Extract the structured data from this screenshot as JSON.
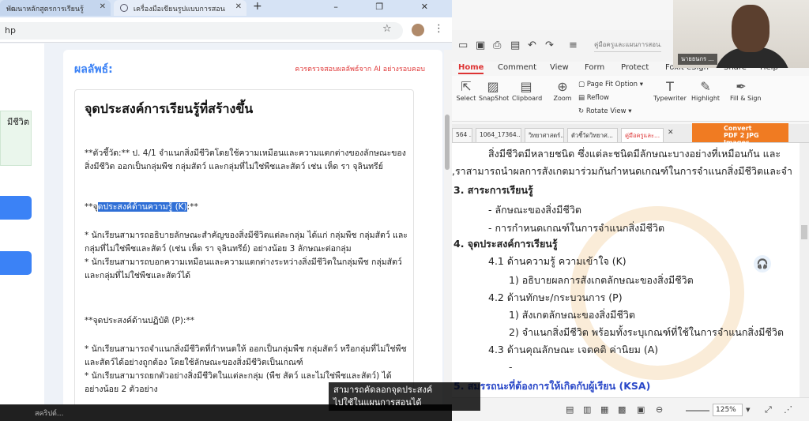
{
  "chrome": {
    "tabs": [
      {
        "label": "พัฒนาหลักสูตรการเรียนรู้"
      },
      {
        "label": "เครื่องมือเขียนรูปแบบการสอน"
      }
    ],
    "newtab": "+",
    "url": "hp",
    "window_controls": "–  ❐  ✕"
  },
  "webpage": {
    "left_text": "มีชีวิต",
    "result_title": "ผลลัพธ์:",
    "result_warning": "ควรตรวจสอบผลลัพธ์จาก AI อย่างรอบคอบ",
    "content": {
      "heading": "จุดประสงค์การเรียนรู้ที่สร้างขึ้น",
      "indicator": "**ตัวชี้วัด:** ป. 4/1 จำแนกสิ่งมีชีวิตโดยใช้ความเหมือนและความแตกต่างของลักษณะของสิ่งมีชีวิต ออกเป็นกลุ่มพืช กลุ่มสัตว์ และกลุ่มที่ไม่ใช่พืชและสัตว์ เช่น เห็ด รา จุลินทรีย์",
      "k_prefix": "**จ",
      "k_highlight": "ุดประสงค์ด้านความรู้ (K)",
      "k_suffix": ":**",
      "k_items": "* นักเรียนสามารถอธิบายลักษณะสำคัญของสิ่งมีชีวิตแต่ละกลุ่ม ได้แก่ กลุ่มพืช กลุ่มสัตว์ และกลุ่มที่ไม่ใช่พืชและสัตว์ (เช่น เห็ด รา จุลินทรีย์) อย่างน้อย 3 ลักษณะต่อกลุ่ม\n* นักเรียนสามารถบอกความเหมือนและความแตกต่างระหว่างสิ่งมีชีวิตในกลุ่มพืช กลุ่มสัตว์ และกลุ่มที่ไม่ใช่พืชและสัตว์ได้",
      "p_heading": "**จุดประสงค์ด้านปฏิบัติ (P):**",
      "p_items": "* นักเรียนสามารถจำแนกสิ่งมีชีวิตที่กำหนดให้ ออกเป็นกลุ่มพืช กลุ่มสัตว์ หรือกลุ่มที่ไม่ใช่พืชและสัตว์ได้อย่างถูกต้อง โดยใช้ลักษณะของสิ่งมีชีวิตเป็นเกณฑ์\n* นักเรียนสามารถยกตัวอย่างสิ่งมีชีวิตในแต่ละกลุ่ม (พืช สัตว์ และไม่ใช่พืชและสัตว์) ได้อย่างน้อย 2 ตัวอย่าง"
    }
  },
  "pdf": {
    "title_field": "คู่มือครูและแผนการสอน...",
    "ribbon_tabs": [
      "Home",
      "Comment",
      "View",
      "Form",
      "Protect",
      "Foxit eSign",
      "Share",
      "Help"
    ],
    "ribbon_buttons": {
      "select": "Select",
      "snapshot": "SnapShot",
      "clipboard": "Clipboard",
      "zoom": "Zoom",
      "page_fit": "Page Fit Option",
      "reflow": "Reflow",
      "rotate": "Rotate View",
      "typewriter": "Typewriter",
      "highlight": "Highlight",
      "fill_sign": "Fill & Sign"
    },
    "doc_tabs": [
      "564 ...",
      "1064_17364...",
      "วิทยาศาสตร์...",
      "ตัวชี้วัดวิทยาศ...",
      "คู่มือครูและ..."
    ],
    "convert": {
      "line1": "Convert",
      "line2": "PDF 2 JPG Images"
    },
    "page_lines": {
      "l1": "สิ่งมีชีวิตมีหลายชนิด ซึ่งแต่ละชนิดมีลักษณะบางอย่างที่เหมือนกัน และ",
      "l2": ",ราสามารถนำผลการสังเกตมาร่วมกันกำหนดเกณฑ์ในการจำแนกสิ่งมีชีวิตและจำ",
      "l3": "3. สาระการเรียนรู้",
      "l4": "- ลักษณะของสิ่งมีชีวิต",
      "l5": "- การกำหนดเกณฑ์ในการจำแนกสิ่งมีชีวิต",
      "l6": "4. จุดประสงค์การเรียนรู้",
      "l7": "4.1 ด้านความรู้ ความเข้าใจ (K)",
      "l8": "1) อธิบายผลการสังเกตลักษณะของสิ่งมีชีวิต",
      "l9": "4.2 ด้านทักษะ/กระบวนการ (P)",
      "l10": "1) สังเกตลักษณะของสิ่งมีชีวิต",
      "l11": "2) จำแนกสิ่งมีชีวิต พร้อมทั้งระบุเกณฑ์ที่ใช้ในการจำแนกสิ่งมีชีวิต",
      "l12": "4.3 ด้านคุณลักษณะ เจตคติ ค่านิยม (A)",
      "l13": "-",
      "l14": "5. สมรรถนะที่ต้องการให้เกิดกับผู้เรียน (KSA)"
    },
    "zoom_level": "125%"
  },
  "video": {
    "name": "นายธนกร ..."
  },
  "taskbar": {
    "label": "สคริปต์..."
  },
  "caption": {
    "line1": "สามารถคัดลอกจุดประสงค์",
    "line2": "ไปใช้ในแผนการสอนได้"
  }
}
